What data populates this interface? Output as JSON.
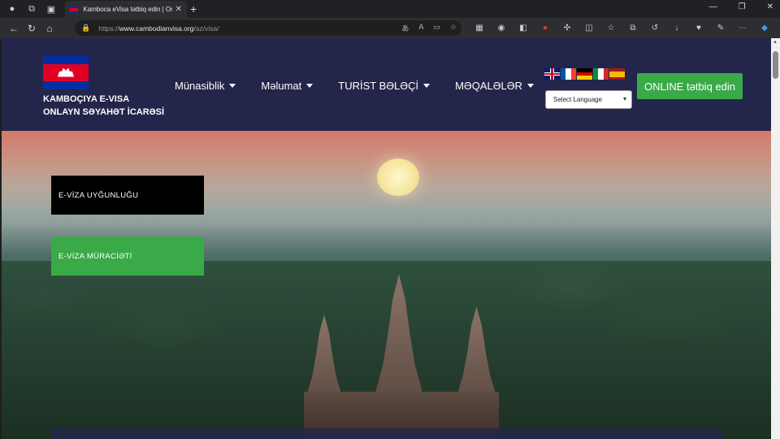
{
  "browser": {
    "tab_title": "Kamboca eVisa tətbiq edin | Onl",
    "url_prefix": "https://",
    "url_domain": "www.cambodianvisa.org",
    "url_path": "/az/visa/"
  },
  "header": {
    "brand_line1": "KAMBOÇIYA E-VISA",
    "brand_line2": "ONLAYN SƏYAHƏT İCARƏSİ",
    "menu": [
      {
        "label": "Münasiblik"
      },
      {
        "label": "Məlumat"
      },
      {
        "label": "TURİST BƏLƏÇİ"
      },
      {
        "label": "MƏQALƏLƏR"
      }
    ],
    "language_select": "Select Language",
    "apply_button": "ONLINE tətbiq edin"
  },
  "hero": {
    "eligibility_button": "E-VİZA UYĞUNLUĞU",
    "application_button": "E-VİZA MÜRACİƏTİ"
  },
  "colors": {
    "header_bg": "#24254a",
    "accent_green": "#3aaa48",
    "black_button": "#000000"
  }
}
